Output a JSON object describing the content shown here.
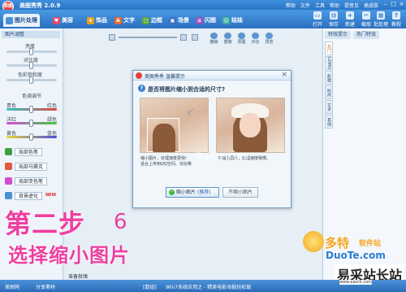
{
  "app": {
    "title": "美图秀秀 2.0.9",
    "logo_text": "美图"
  },
  "top_menu": [
    "帮助",
    "文件",
    "工具",
    "帮助",
    "提意见",
    "换皮肤"
  ],
  "tabs": [
    {
      "label": "图片处理",
      "icon": "photo-icon",
      "color": "#4a8fd6"
    },
    {
      "label": "美容",
      "icon": "heart-icon",
      "color": "#e84870"
    },
    {
      "label": "饰品",
      "icon": "gift-icon",
      "color": "#e8a020"
    },
    {
      "label": "文字",
      "icon": "text-icon",
      "color": "#e66a2c"
    },
    {
      "label": "边框",
      "icon": "frame-icon",
      "color": "#5aa83a"
    },
    {
      "label": "场景",
      "icon": "scene-icon",
      "color": "#3a6fc8"
    },
    {
      "label": "闪图",
      "icon": "flash-icon",
      "color": "#9a52c4"
    },
    {
      "label": "娃娃",
      "icon": "doll-icon",
      "color": "#3fb0a0"
    }
  ],
  "right_toolbar": [
    "打开",
    "保存",
    "新建",
    "截取",
    "批处理",
    "教程"
  ],
  "canvas_buttons": [
    "撤销",
    "重做",
    "原图",
    "对比",
    "预览"
  ],
  "left_panel": {
    "header": "图片调整",
    "sliders": [
      "亮度",
      "对比度",
      "色彩饱和度",
      "色调调节"
    ],
    "color_pairs": [
      [
        "青色",
        "红色"
      ],
      [
        "洋红",
        "绿色"
      ],
      [
        "黄色",
        "蓝色"
      ]
    ],
    "effects": [
      {
        "label": "局部色笔",
        "color": "#3fa03f"
      },
      {
        "label": "局部马赛克",
        "color": "#e05a3a"
      },
      {
        "label": "局部变色笔",
        "color": "#d44ad4"
      },
      {
        "label": "背景虚化",
        "color": "#4a8fd6"
      }
    ],
    "new_badge": "NEW"
  },
  "right_panel": {
    "tabs": [
      "特效提示",
      "热门特效"
    ],
    "categories": [
      "热门",
      "LOMO",
      "影楼",
      "时尚",
      "艺术",
      "其他"
    ],
    "active_category": "热门"
  },
  "dialog": {
    "title": "美图秀秀 温馨提示",
    "question": "是否将图片缩小到合适的尺寸?",
    "option_left_desc": "缩小图片，处理速度更快!\n适合上传到QQ空间、论坛等",
    "option_right_desc": "不缩小图片，处理速度稍慢。",
    "btn_shrink": "缩小图片",
    "btn_shrink_note": "(推荐)",
    "btn_noshrink": "不缩小图片"
  },
  "overlay": {
    "step": "第二步",
    "instruction": "选择缩小图片",
    "swirl": "6"
  },
  "statusbar": {
    "app_name": "美图网",
    "share": "分享素材",
    "zoom": "[数组]",
    "info": "Win7系统应用之 - 精美电影海报轻松做",
    "hint": "准备就绪"
  },
  "watermarks": {
    "duote_cn": "多特",
    "duote_sub": "软件站",
    "duote_url": "DuoTe.com",
    "site": "易采站长站",
    "site_url": "www.easck.com",
    "mid": "Duote.com"
  }
}
